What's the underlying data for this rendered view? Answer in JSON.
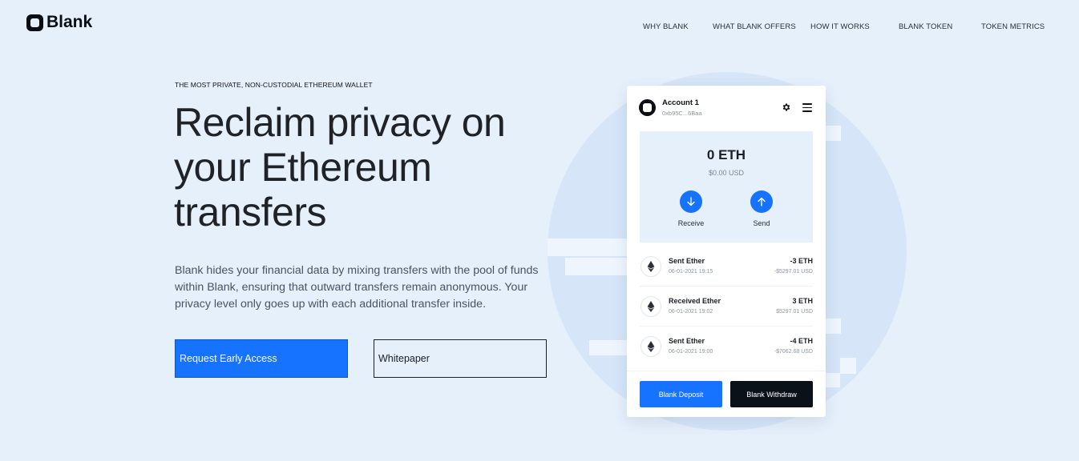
{
  "brand": {
    "name": "Blank"
  },
  "nav": {
    "items": [
      {
        "label": "WHY BLANK"
      },
      {
        "label": "WHAT BLANK OFFERS"
      },
      {
        "label": "HOW IT WORKS"
      },
      {
        "label": "BLANK TOKEN"
      },
      {
        "label": "TOKEN METRICS"
      }
    ]
  },
  "hero": {
    "eyebrow": "THE MOST PRIVATE, NON-CUSTODIAL ETHEREUM WALLET",
    "headline": [
      "Reclaim privacy on",
      "your Ethereum",
      "transfers"
    ],
    "description": "Blank hides your financial data by mixing transfers with the pool of funds within Blank, ensuring that outward transfers remain anonymous. Your privacy level only goes up with each additional transfer inside.",
    "primary_button": "Request Early Access",
    "secondary_button": "Whitepaper"
  },
  "wallet": {
    "account_name": "Account 1",
    "account_address": "0xb95C...6Baa",
    "balance_eth": "0 ETH",
    "balance_usd": "$0.00 USD",
    "receive_label": "Receive",
    "send_label": "Send",
    "transactions": [
      {
        "title": "Sent Ether",
        "date": "06-01-2021 19:15",
        "amount": "-3 ETH",
        "usd": "-$5297.01 USD"
      },
      {
        "title": "Received Ether",
        "date": "06-01-2021 19:02",
        "amount": "3 ETH",
        "usd": "$5297.01 USD"
      },
      {
        "title": "Sent Ether",
        "date": "06-01-2021 19:00",
        "amount": "-4 ETH",
        "usd": "-$7062.68 USD"
      }
    ],
    "deposit_label": "Blank Deposit",
    "withdraw_label": "Blank Withdraw"
  },
  "colors": {
    "background": "#e6f0fb",
    "accent": "#1673ff",
    "dark": "#0b1118"
  },
  "icons": [
    "logo-icon",
    "gear-icon",
    "menu-icon",
    "arrow-down-icon",
    "arrow-up-icon",
    "ethereum-icon"
  ]
}
